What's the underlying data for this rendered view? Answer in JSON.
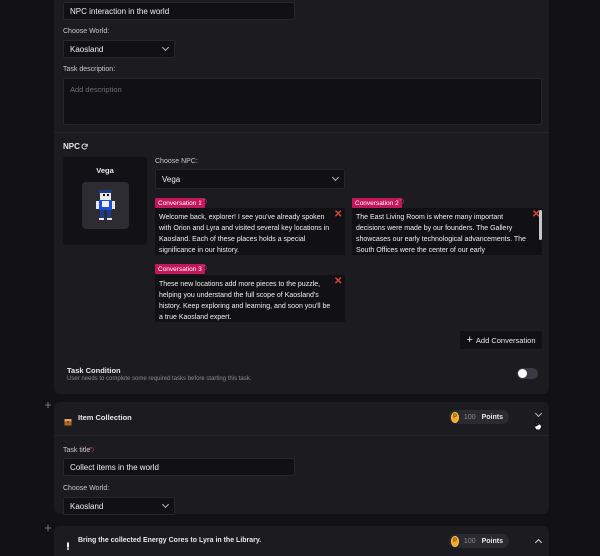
{
  "task1": {
    "title_value": "NPC interaction in the world",
    "world_label": "Choose World:",
    "world_value": "Kaosland",
    "description_label": "Task description:",
    "description_placeholder": "Add description",
    "npc_section_label": "NPC",
    "npc_name": "Vega",
    "choose_npc_label": "Choose NPC:",
    "npc_value": "Vega",
    "required_mark": "(*)",
    "conversations": [
      {
        "label": "Conversation 1",
        "text": "Welcome back, explorer! I see you've already spoken with Orion and Lyra and visited several key locations in Kaosland. Each of these places holds a special significance in our history."
      },
      {
        "label": "Conversation 2",
        "text": "The East Living Room is where many important decisions were made by our founders. The Gallery showcases our early technological advancements. The South Offices were the center of our early administrative efforts, and the Checkpoint in the South..."
      },
      {
        "label": "Conversation 3",
        "text": "These new locations add more pieces to the puzzle, helping you understand the full scope of Kaosland's history. Keep exploring and learning, and soon you'll be a true Kaosland expert."
      }
    ],
    "add_conversation_label": "Add Conversation",
    "condition_title": "Task Condition",
    "condition_desc": "User needs to complete some required tasks before starting this task."
  },
  "task2": {
    "name": "Item Collection",
    "points_value": "100",
    "points_label": "Points",
    "title_label": "Task title",
    "required_mark": "(*)",
    "title_value": "Collect items in the world",
    "world_label": "Choose World:",
    "world_value": "Kaosland"
  },
  "task3": {
    "name": "Bring the collected Energy Cores to Lyra in the Library.",
    "points_value": "100",
    "points_label": "Points"
  },
  "colors": {
    "accent": "#c2185b",
    "coin": "#f5a623",
    "background": "#121216",
    "panel": "#1b1b20"
  }
}
